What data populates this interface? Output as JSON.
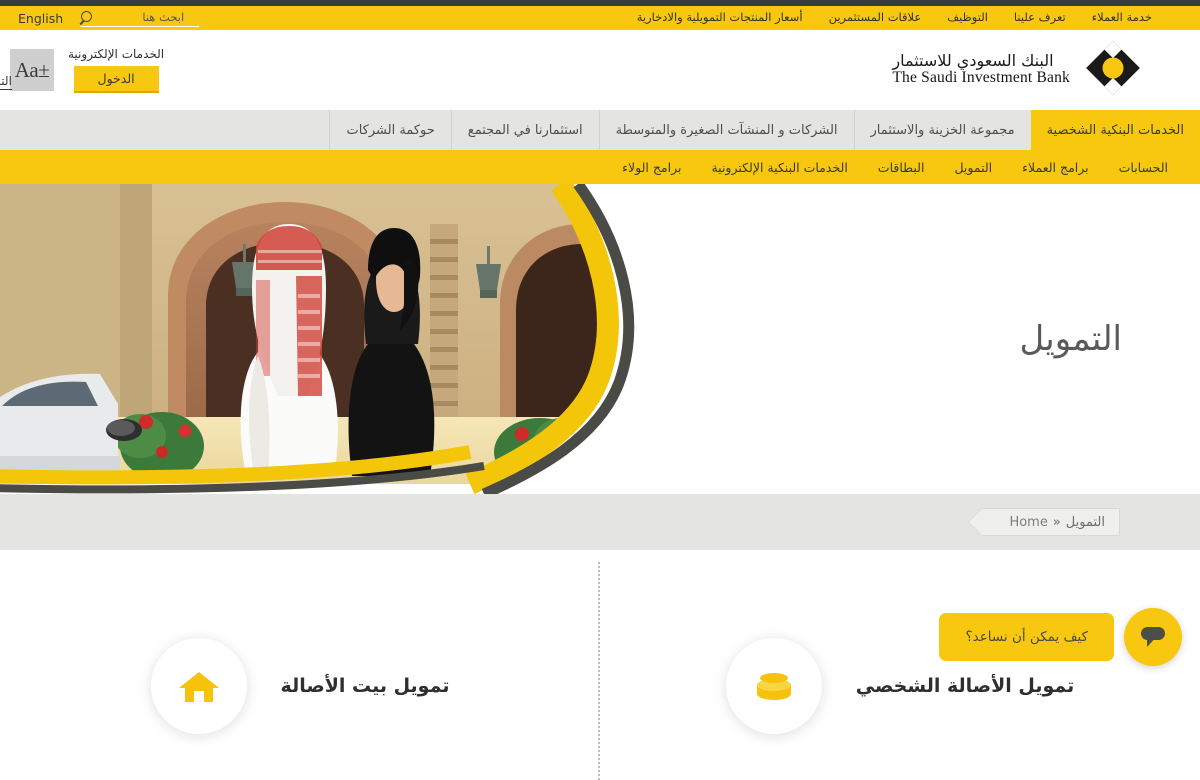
{
  "topbar": {
    "search_placeholder": "ابحث هنا",
    "search_value": "",
    "language": "English",
    "links": [
      {
        "label": "خدمة العملاء"
      },
      {
        "label": "تعرف علينا"
      },
      {
        "label": "التوظيف"
      },
      {
        "label": "علاقات المستثمرين"
      },
      {
        "label": "أسعار المنتجات التمويلية والادخارية"
      }
    ]
  },
  "header": {
    "logo_ar": "البنك السعودي للاستثمار",
    "logo_en": "The Saudi Investment Bank",
    "eservices_label": "الخدمات الإلكترونية",
    "login_label": "الدخول",
    "font_size_label": "Aa±",
    "edge_link": "التس"
  },
  "mainnav": {
    "items": [
      {
        "label": "الخدمات البنكية الشخصية",
        "active": true
      },
      {
        "label": "مجموعة الخزينة والاستثمار",
        "active": false
      },
      {
        "label": "الشركات و المنشآت الصغيرة والمتوسطة",
        "active": false
      },
      {
        "label": "استثمارنا في المجتمع",
        "active": false
      },
      {
        "label": "حوكمة الشركات",
        "active": false
      }
    ]
  },
  "subnav": {
    "items": [
      {
        "label": "الحسابات"
      },
      {
        "label": "برامج العملاء"
      },
      {
        "label": "التمويل"
      },
      {
        "label": "البطاقات"
      },
      {
        "label": "الخدمات البنكية الإلكترونية"
      },
      {
        "label": "برامج الولاء"
      }
    ]
  },
  "hero": {
    "title": "التمويل"
  },
  "breadcrumb": {
    "home": "Home",
    "separator": "«",
    "current": "التمويل"
  },
  "cards": [
    {
      "title": "تمويل الأصالة الشخصي",
      "icon": "coins-icon"
    },
    {
      "title": "تمويل بيت الأصالة",
      "icon": "house-icon"
    }
  ],
  "chat": {
    "label": "كيف يمكن أن نساعد؟",
    "icon": "chat-bubble-icon"
  },
  "colors": {
    "brand_yellow": "#f8c810",
    "dark_strip": "#3a3a38",
    "nav_gray": "#e4e4e2",
    "text_dark": "#3a3a38"
  }
}
